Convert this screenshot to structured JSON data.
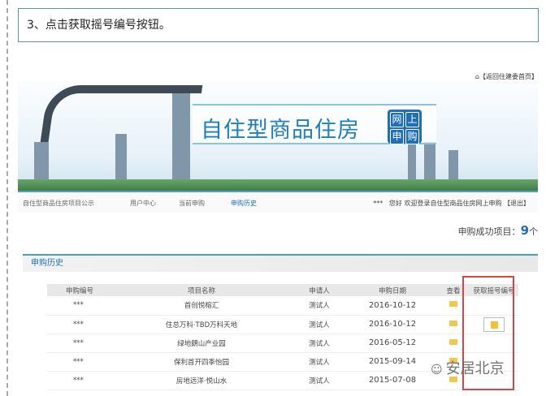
{
  "caption": "3、点击获取摇号编号按钮。",
  "home_link": "【返回住建委首页】",
  "banner": {
    "title": "自住型商品住房",
    "badge": [
      "网",
      "上",
      "申",
      "购"
    ]
  },
  "nav": {
    "items": [
      "自住型商品住房项目公示",
      "用户中心",
      "当前申购",
      "申购历史"
    ],
    "active": 3,
    "user": "***",
    "welcome": "您好 欢迎登录自住型商品住房网上申购",
    "logout": "【退出】"
  },
  "summary": {
    "label": "申购成功项目：",
    "count": "9",
    "unit": "个"
  },
  "section_title": "申购历史",
  "table": {
    "headers": [
      "申购编号",
      "项目名称",
      "申请人",
      "申购日期",
      "查看",
      "获取摇号编号"
    ],
    "rows": [
      {
        "id": "***",
        "name": "首创悦榕汇",
        "applicant": "测试人",
        "date": "2016-10-12",
        "get": false
      },
      {
        "id": "***",
        "name": "住总万科·TBD万科天地",
        "applicant": "测试人",
        "date": "2016-10-12",
        "get": true
      },
      {
        "id": "***",
        "name": "绿地朗山产业园",
        "applicant": "测试人",
        "date": "2016-05-12",
        "get": false
      },
      {
        "id": "***",
        "name": "保利首开四季怡园",
        "applicant": "测试人",
        "date": "2015-09-14",
        "get": false
      },
      {
        "id": "***",
        "name": "房地远洋·悦山水",
        "applicant": "测试人",
        "date": "2015-07-08",
        "get": false
      }
    ]
  },
  "watermark": "安居北京",
  "colors": {
    "accent": "#1f6fb8",
    "highlight": "#d9434a"
  }
}
